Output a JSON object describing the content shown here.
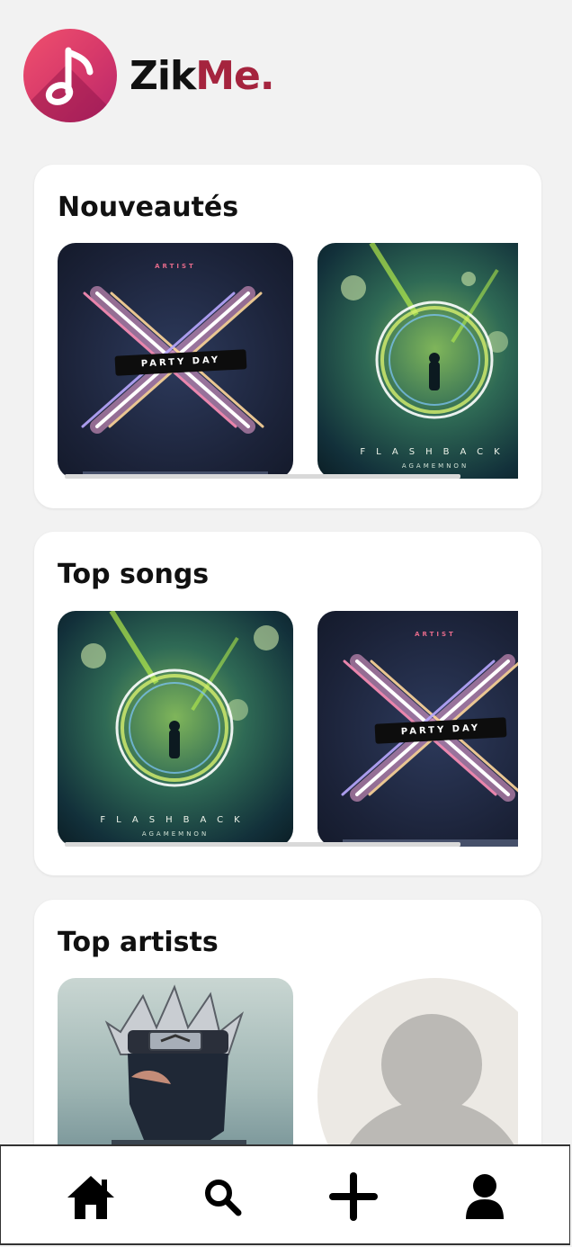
{
  "app": {
    "brand_part1": "Zik",
    "brand_part2": "Me.",
    "brand_color": "#a5243e",
    "logo_icon": "music-note-icon"
  },
  "sections": [
    {
      "title": "Nouveautés",
      "items": [
        {
          "art": "party-day",
          "artist_text": "ARTIST",
          "title_text": "PARTY DAY"
        },
        {
          "art": "flashback",
          "title_text": "FLASHBACK",
          "artist_text": "AGAMEMNON"
        }
      ]
    },
    {
      "title": "Top songs",
      "items": [
        {
          "art": "flashback",
          "title_text": "FLASHBACK",
          "artist_text": "AGAMEMNON"
        },
        {
          "art": "party-day",
          "artist_text": "ARTIST",
          "title_text": "PARTY DAY"
        }
      ]
    },
    {
      "title": "Top artists",
      "items": [
        {
          "art": "artist-photo"
        },
        {
          "art": "default-avatar"
        }
      ]
    }
  ],
  "bottom_nav": [
    {
      "icon": "home-icon"
    },
    {
      "icon": "search-icon"
    },
    {
      "icon": "plus-icon"
    },
    {
      "icon": "user-icon"
    }
  ]
}
